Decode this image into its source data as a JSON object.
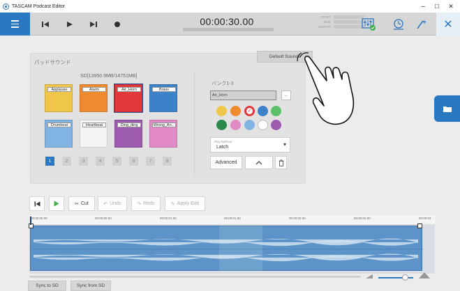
{
  "window": {
    "title": "TASCAM Podcast Editor",
    "minimize": "–",
    "maximize": "☐",
    "close": "✕"
  },
  "toolbar": {
    "time": "00:00:30.00",
    "meta_labels": [
      "START",
      "END",
      "LENGTH"
    ],
    "accent": "#2b78c2"
  },
  "pad_panel": {
    "title": "パッドサウンド",
    "default_sounds": "Default Sounds",
    "sd_info": "SD[13950.9MB/14751MB]",
    "pads": [
      {
        "label": "Applause",
        "color": "#f0c64a"
      },
      {
        "label": "Alarm",
        "color": "#ef8a2e"
      },
      {
        "label": "Air_Horn",
        "color": "#e2383c",
        "selected": true
      },
      {
        "label": "Brass",
        "color": "#3b82c9"
      },
      {
        "label": "Drumbeat",
        "color": "#82b4e3"
      },
      {
        "label": "Heartbeat",
        "color": "#f3f3f3"
      },
      {
        "label": "Ding_ding",
        "color": "#9d5bb0"
      },
      {
        "label": "Wrong_An...",
        "color": "#e28ac6"
      }
    ],
    "pages": [
      "1",
      "2",
      "3",
      "4",
      "5",
      "6",
      "7",
      "8"
    ],
    "active_page": "1"
  },
  "bank_panel": {
    "bank_label": "バンク1-3",
    "name_value": "Air_Horn",
    "dots": "...",
    "colors": [
      "#f0c64a",
      "#ef8a2e",
      "#e2383c",
      "#3b82c9",
      "#5cc06a",
      "#2c8a4a",
      "#e28ac6",
      "#82b4e3",
      "#ffffff",
      "#9d5bb0"
    ],
    "play_method_caption": "Play Method",
    "play_method_value": "Latch",
    "advanced": "Advanced"
  },
  "edit_toolbar": {
    "cut": "Cut",
    "undo": "Undo",
    "redo": "Redo",
    "apply": "Apply Edit"
  },
  "timeline": {
    "ticks": [
      "00:00:00.00",
      "00:00:00.50",
      "00:00:01.00",
      "00:00:01.50",
      "00:00:02.00",
      "00:00:02.50",
      "00:00:03"
    ]
  },
  "footer": {
    "sync_to_sd": "Sync to SD",
    "sync_from_sd": "Sync from SD"
  }
}
